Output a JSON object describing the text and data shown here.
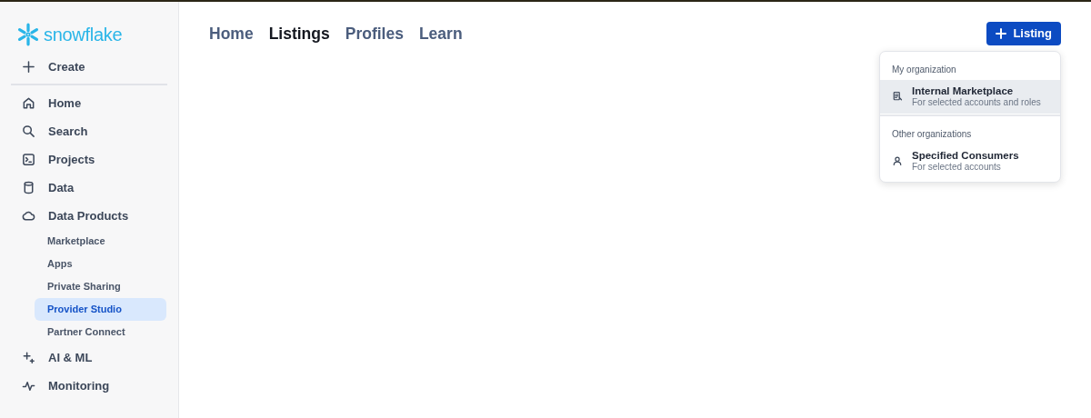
{
  "logo": {
    "text": "snowflake"
  },
  "sidebar": {
    "create": {
      "label": "Create"
    },
    "items": [
      {
        "label": "Home"
      },
      {
        "label": "Search"
      },
      {
        "label": "Projects"
      },
      {
        "label": "Data"
      },
      {
        "label": "Data Products",
        "children": [
          {
            "label": "Marketplace",
            "selected": false
          },
          {
            "label": "Apps",
            "selected": false
          },
          {
            "label": "Private Sharing",
            "selected": false
          },
          {
            "label": "Provider Studio",
            "selected": true
          },
          {
            "label": "Partner Connect",
            "selected": false
          }
        ]
      },
      {
        "label": "AI & ML"
      },
      {
        "label": "Monitoring"
      }
    ]
  },
  "tabs": [
    {
      "label": "Home",
      "selected": false
    },
    {
      "label": "Listings",
      "selected": true
    },
    {
      "label": "Profiles",
      "selected": false
    },
    {
      "label": "Learn",
      "selected": false
    }
  ],
  "listing_button": {
    "label": "Listing"
  },
  "menu": {
    "sections": [
      {
        "heading": "My organization",
        "items": [
          {
            "title": "Internal Marketplace",
            "subtitle": "For selected accounts and roles",
            "selected": true
          }
        ]
      },
      {
        "heading": "Other organizations",
        "items": [
          {
            "title": "Specified Consumers",
            "subtitle": "For selected accounts",
            "selected": false
          }
        ]
      }
    ]
  }
}
